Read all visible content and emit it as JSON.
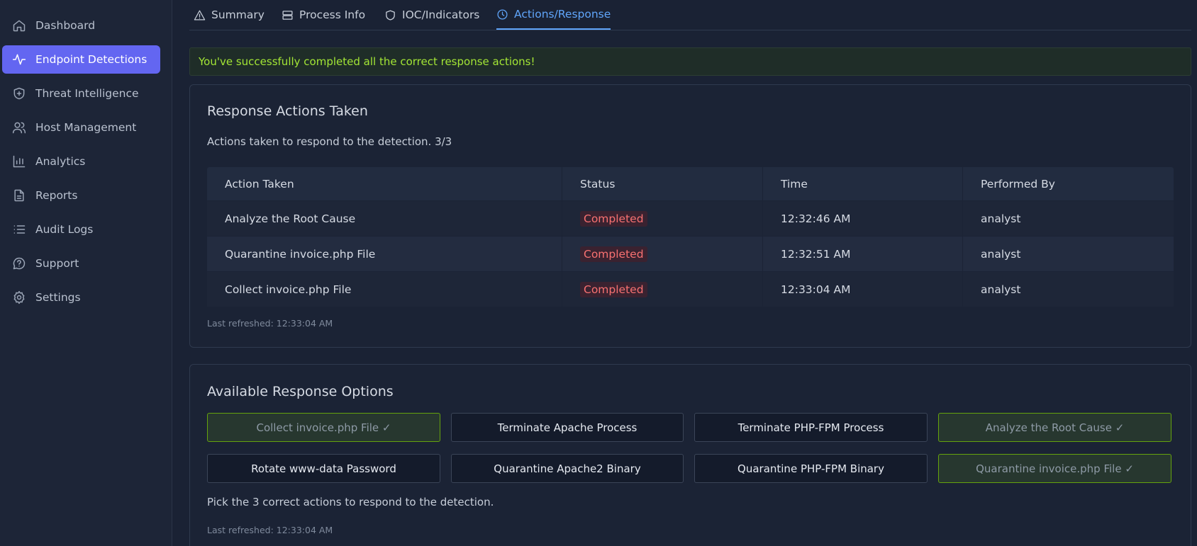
{
  "sidebar": {
    "items": [
      {
        "label": "Dashboard",
        "icon": "home-icon",
        "active": false
      },
      {
        "label": "Endpoint Detections",
        "icon": "activity-icon",
        "active": true
      },
      {
        "label": "Threat Intelligence",
        "icon": "shield-plus-icon",
        "active": false
      },
      {
        "label": "Host Management",
        "icon": "users-icon",
        "active": false
      },
      {
        "label": "Analytics",
        "icon": "bar-chart-icon",
        "active": false
      },
      {
        "label": "Reports",
        "icon": "file-text-icon",
        "active": false
      },
      {
        "label": "Audit Logs",
        "icon": "list-icon",
        "active": false
      },
      {
        "label": "Support",
        "icon": "message-help-icon",
        "active": false
      },
      {
        "label": "Settings",
        "icon": "gear-icon",
        "active": false
      }
    ]
  },
  "tabs": [
    {
      "label": "Summary",
      "icon": "alert-triangle-icon"
    },
    {
      "label": "Process Info",
      "icon": "server-icon"
    },
    {
      "label": "IOC/Indicators",
      "icon": "shield-icon"
    },
    {
      "label": "Actions/Response",
      "icon": "clock-icon",
      "active": true
    }
  ],
  "alert": {
    "text": "You've successfully completed all the correct response actions!"
  },
  "actions_taken": {
    "title": "Response Actions Taken",
    "subtitle": "Actions taken to respond to the detection. 3/3",
    "columns": [
      "Action Taken",
      "Status",
      "Time",
      "Performed By"
    ],
    "rows": [
      {
        "action": "Analyze the Root Cause",
        "status": "Completed",
        "time": "12:32:46 AM",
        "by": "analyst"
      },
      {
        "action": "Quarantine invoice.php File",
        "status": "Completed",
        "time": "12:32:51 AM",
        "by": "analyst"
      },
      {
        "action": "Collect invoice.php File",
        "status": "Completed",
        "time": "12:33:04 AM",
        "by": "analyst"
      }
    ],
    "last_refreshed": "Last refreshed: 12:33:04 AM"
  },
  "options": {
    "title": "Available Response Options",
    "buttons": [
      {
        "label": "Collect invoice.php File ✓",
        "done": true
      },
      {
        "label": "Terminate Apache Process",
        "done": false
      },
      {
        "label": "Terminate PHP-FPM Process",
        "done": false
      },
      {
        "label": "Analyze the Root Cause ✓",
        "done": true
      },
      {
        "label": "Rotate www-data Password",
        "done": false
      },
      {
        "label": "Quarantine Apache2 Binary",
        "done": false
      },
      {
        "label": "Quarantine PHP-FPM Binary",
        "done": false
      },
      {
        "label": "Quarantine invoice.php File ✓",
        "done": true
      }
    ],
    "hint": "Pick the 3 correct actions to respond to the detection.",
    "last_refreshed": "Last refreshed: 12:33:04 AM"
  },
  "colors": {
    "accent": "#6366f1",
    "tab_active": "#60a5fa",
    "success_text": "#a3e635",
    "badge_text": "#f87171",
    "done_border": "#65a30d"
  }
}
